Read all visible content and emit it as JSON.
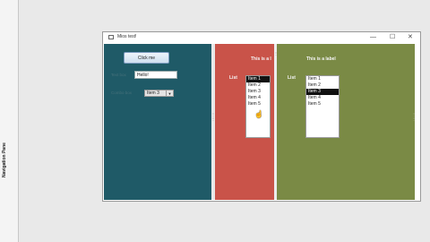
{
  "nav": {
    "label": "Navigation Pane"
  },
  "window": {
    "title": "Mios test!",
    "controls": {
      "minimize": "—",
      "maximize": "☐",
      "close": "✕"
    }
  },
  "teal": {
    "button_label": "Click me",
    "textbox_label": "Text box",
    "textbox_value": "Hello!",
    "combo_label": "Combo box",
    "combo_value": "Item 3"
  },
  "red": {
    "header": "This is a l",
    "list_label": "List",
    "items": [
      "Item 1",
      "Item 2",
      "Item 3",
      "Item 4",
      "Item 5"
    ],
    "selected_index": 0
  },
  "green": {
    "header": "This is a label",
    "list_label": "List",
    "items": [
      "Item 1",
      "Item 2",
      "Item 3",
      "Item 4",
      "Item 5"
    ],
    "selected_index": 2
  },
  "colors": {
    "teal": "#1f5a67",
    "red": "#c95349",
    "green": "#7a8a45"
  }
}
